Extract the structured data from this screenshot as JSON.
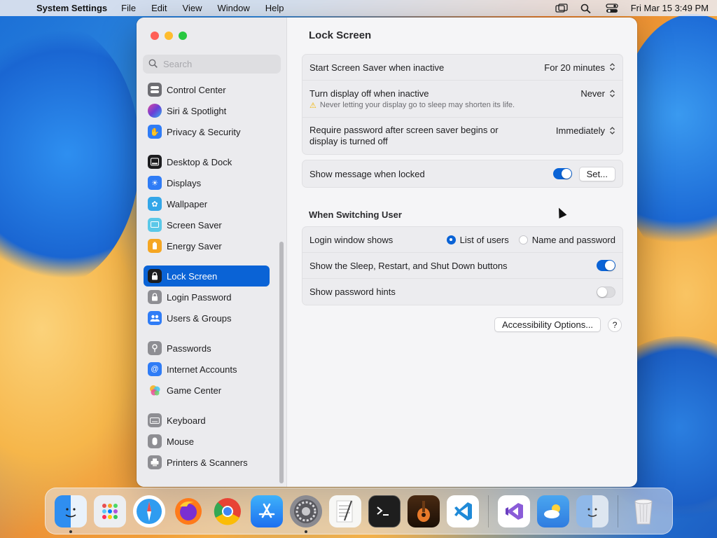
{
  "menubar": {
    "app_name": "System Settings",
    "menus": [
      "File",
      "Edit",
      "View",
      "Window",
      "Help"
    ],
    "clock": "Fri Mar 15  3:49 PM"
  },
  "sidebar": {
    "search_placeholder": "Search",
    "items": [
      {
        "label": "Control Center",
        "icon": "control-center-icon",
        "color": "#6e6e73"
      },
      {
        "label": "Siri & Spotlight",
        "icon": "siri-icon",
        "color": "#8a3fd1"
      },
      {
        "label": "Privacy & Security",
        "icon": "hand-icon",
        "color": "#2f7cf6"
      },
      {
        "label": "Desktop & Dock",
        "icon": "dock-icon",
        "color": "#1d1d1f"
      },
      {
        "label": "Displays",
        "icon": "sun-icon",
        "color": "#2f7cf6"
      },
      {
        "label": "Wallpaper",
        "icon": "flower-icon",
        "color": "#33a6e8"
      },
      {
        "label": "Screen Saver",
        "icon": "screen-saver-icon",
        "color": "#5ac8e8"
      },
      {
        "label": "Energy Saver",
        "icon": "battery-icon",
        "color": "#f5a623"
      },
      {
        "label": "Lock Screen",
        "icon": "lock-icon",
        "color": "#1d1d1f"
      },
      {
        "label": "Login Password",
        "icon": "lock-icon",
        "color": "#8e8e93"
      },
      {
        "label": "Users & Groups",
        "icon": "users-icon",
        "color": "#2f7cf6"
      },
      {
        "label": "Passwords",
        "icon": "key-icon",
        "color": "#8e8e93"
      },
      {
        "label": "Internet Accounts",
        "icon": "at-icon",
        "color": "#2f7cf6"
      },
      {
        "label": "Game Center",
        "icon": "game-center-icon",
        "color": "#e84f7a"
      },
      {
        "label": "Keyboard",
        "icon": "keyboard-icon",
        "color": "#8e8e93"
      },
      {
        "label": "Mouse",
        "icon": "mouse-icon",
        "color": "#8e8e93"
      },
      {
        "label": "Printers & Scanners",
        "icon": "printer-icon",
        "color": "#8e8e93"
      }
    ]
  },
  "main": {
    "title": "Lock Screen",
    "screen_saver_label": "Start Screen Saver when inactive",
    "screen_saver_value": "For 20 minutes",
    "display_off_label": "Turn display off when inactive",
    "display_off_value": "Never",
    "display_off_warning": "Never letting your display go to sleep may shorten its life.",
    "require_password_label": "Require password after screen saver begins or display is turned off",
    "require_password_value": "Immediately",
    "show_message_label": "Show message when locked",
    "show_message_on": true,
    "set_button": "Set...",
    "switching_section": "When Switching User",
    "login_window_label": "Login window shows",
    "login_option_1": "List of users",
    "login_option_2": "Name and password",
    "sleep_buttons_label": "Show the Sleep, Restart, and Shut Down buttons",
    "sleep_buttons_on": true,
    "password_hints_label": "Show password hints",
    "password_hints_on": false,
    "accessibility_button": "Accessibility Options...",
    "help_button": "?"
  },
  "dock": {
    "apps": [
      {
        "name": "finder-icon",
        "color": "#3a8ef0",
        "running": true
      },
      {
        "name": "launchpad-icon",
        "color": "#e6e6ea",
        "running": false
      },
      {
        "name": "safari-icon",
        "color": "#2f9cf0",
        "running": false
      },
      {
        "name": "firefox-icon",
        "color": "#ff7a1a",
        "running": false
      },
      {
        "name": "chrome-icon",
        "color": "#ffffff",
        "running": false
      },
      {
        "name": "app-store-icon",
        "color": "#1c8df5",
        "running": false
      },
      {
        "name": "system-settings-icon",
        "color": "#8a8a90",
        "running": true
      },
      {
        "name": "textedit-icon",
        "color": "#f5f5f5",
        "running": false
      },
      {
        "name": "terminal-icon",
        "color": "#222222",
        "running": false
      },
      {
        "name": "garageband-icon",
        "color": "#e87a2a",
        "running": false
      },
      {
        "name": "vscode-icon",
        "color": "#ffffff",
        "running": false
      },
      {
        "name": "visual-studio-icon",
        "color": "#ffffff",
        "running": false
      },
      {
        "name": "weather-icon",
        "color": "#3b9ef0",
        "running": false
      },
      {
        "name": "migration-assistant-icon",
        "color": "#c8c8cc",
        "running": false
      },
      {
        "name": "trash-icon",
        "color": "#e0e0e4",
        "running": false
      }
    ]
  }
}
